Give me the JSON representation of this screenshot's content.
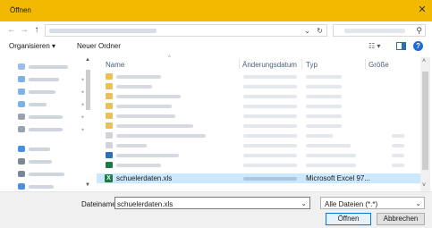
{
  "window": {
    "title": "Öffnen",
    "close_icon": "close-icon"
  },
  "toolbar": {
    "organize": "Organisieren ▾",
    "new_folder": "Neuer Ordner"
  },
  "columns": {
    "name": "Name",
    "date": "Änderungsdatum",
    "type": "Typ",
    "size": "Größe"
  },
  "selected_file": {
    "name": "schuelerdaten.xls",
    "type": "Microsoft Excel 97...",
    "icon_letter": "X"
  },
  "footer": {
    "filename_label": "Dateiname:",
    "filename_value": "schuelerdaten.xls",
    "filter_value": "Alle Dateien (*.*)",
    "open_label": "Öffnen",
    "cancel_label": "Abbrechen"
  },
  "colors": {
    "titlebar": "#f3b900",
    "selection": "#cce8ff",
    "folder": "#e8c15a",
    "excel": "#1d7a44",
    "accent": "#0078d7"
  }
}
